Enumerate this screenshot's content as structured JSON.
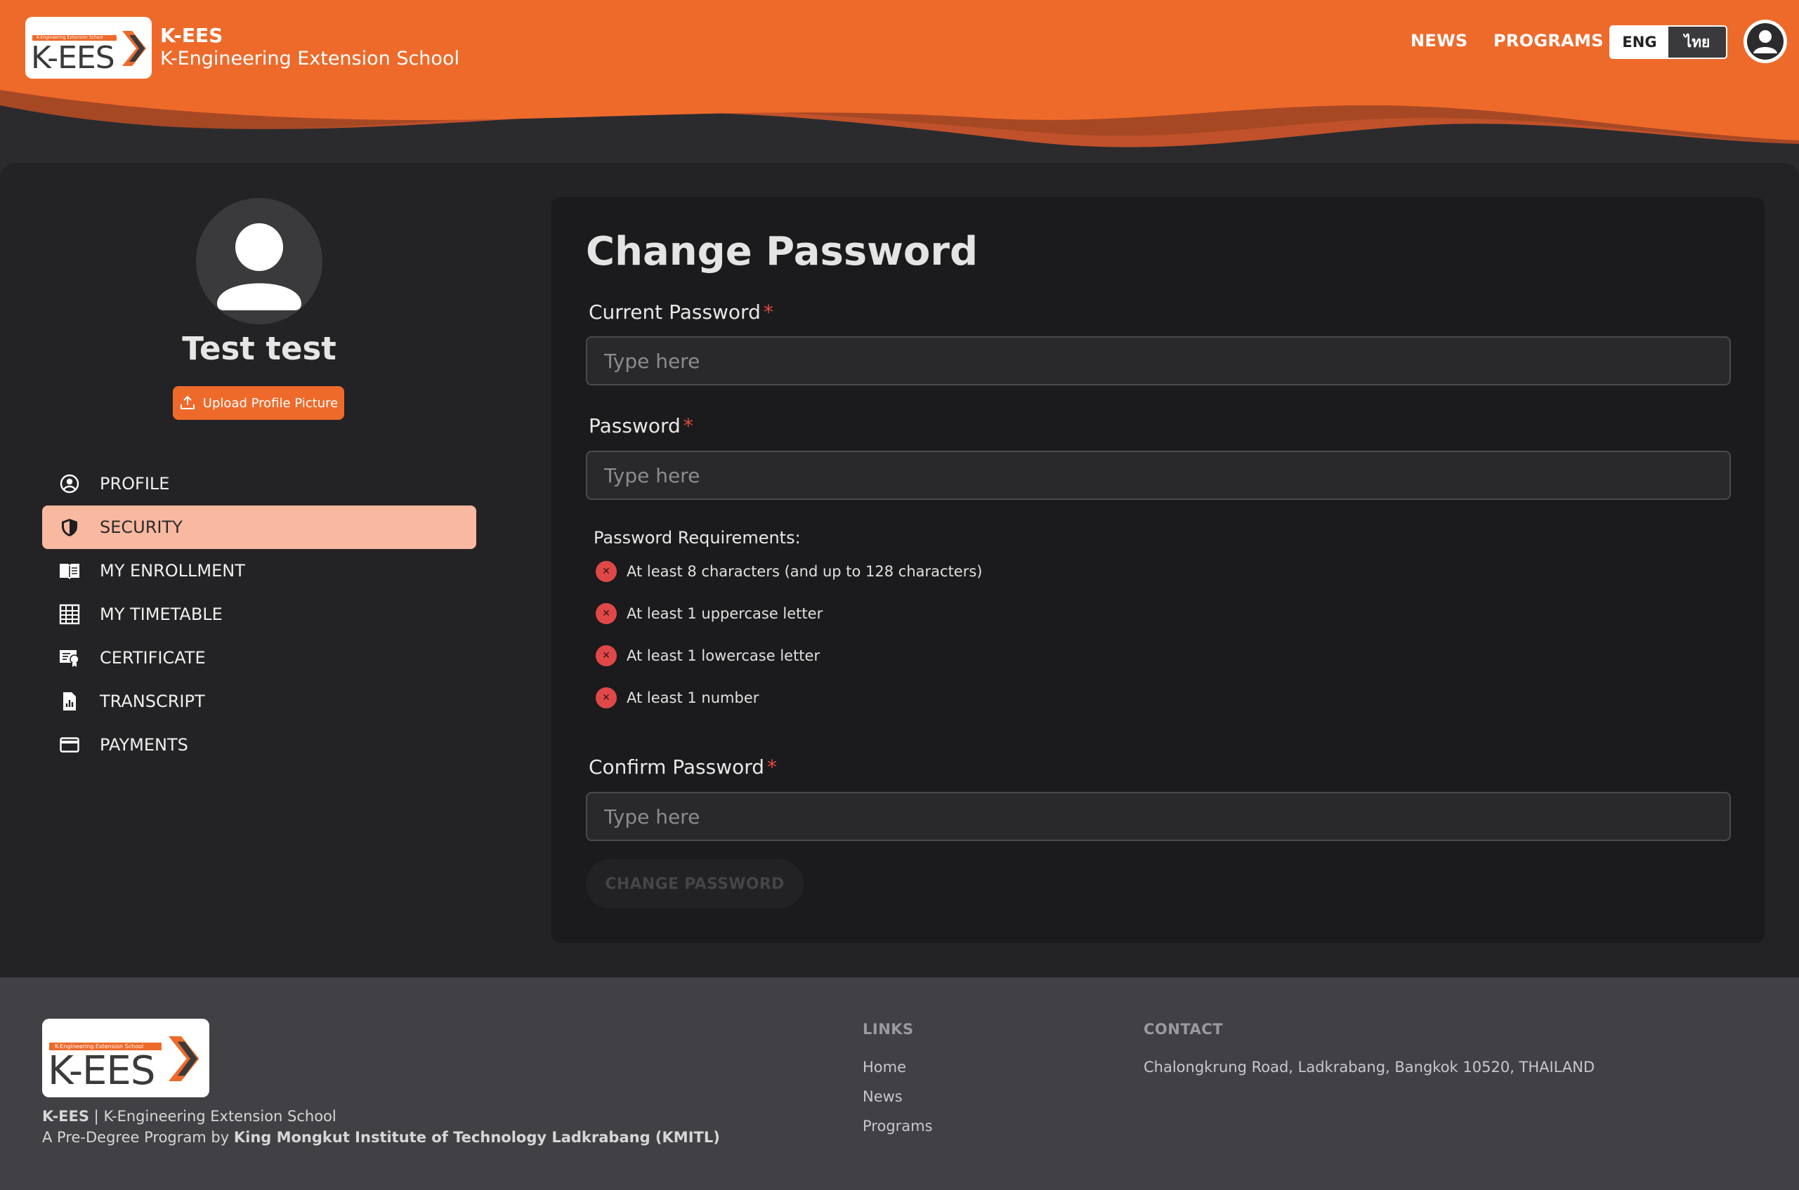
{
  "header": {
    "logo_strip": "K-Engineering Extension School",
    "logo_text": "K-EES",
    "brand_title": "K-EES",
    "brand_subtitle": "K-Engineering Extension School",
    "nav": {
      "news": "NEWS",
      "programs": "PROGRAMS"
    },
    "lang": {
      "eng": "ENG",
      "thai": "ไทย",
      "selected": "ENG"
    },
    "accent_color": "#ee6a2b"
  },
  "profile": {
    "name": "Test test",
    "upload_label": "Upload Profile Picture"
  },
  "sidebar": {
    "items": [
      {
        "label": "PROFILE",
        "icon": "account-circle-icon",
        "active": false
      },
      {
        "label": "SECURITY",
        "icon": "shield-icon",
        "active": true
      },
      {
        "label": "MY ENROLLMENT",
        "icon": "book-open-icon",
        "active": false
      },
      {
        "label": "MY TIMETABLE",
        "icon": "grid-table-icon",
        "active": false
      },
      {
        "label": "CERTIFICATE",
        "icon": "certificate-icon",
        "active": false
      },
      {
        "label": "TRANSCRIPT",
        "icon": "document-chart-icon",
        "active": false
      },
      {
        "label": "PAYMENTS",
        "icon": "credit-card-icon",
        "active": false
      }
    ]
  },
  "form": {
    "title": "Change Password",
    "current_password": {
      "label": "Current Password",
      "required": "*",
      "placeholder": "Type here",
      "value": ""
    },
    "password": {
      "label": "Password",
      "required": "*",
      "placeholder": "Type here",
      "value": ""
    },
    "requirements_title": "Password Requirements:",
    "requirements": [
      {
        "text": "At least 8 characters (and up to 128 characters)",
        "met": false
      },
      {
        "text": "At least 1 uppercase letter",
        "met": false
      },
      {
        "text": "At least 1 lowercase letter",
        "met": false
      },
      {
        "text": "At least 1 number",
        "met": false
      }
    ],
    "confirm_password": {
      "label": "Confirm Password",
      "required": "*",
      "placeholder": "Type here",
      "value": ""
    },
    "submit_label": "CHANGE PASSWORD",
    "submit_enabled": false
  },
  "footer": {
    "brand": "K-EES",
    "brand_full": "K-Engineering Extension School",
    "separator": "|",
    "tagline_prefix": "A Pre-Degree Program by",
    "institution": "King Mongkut Institute of Technology Ladkrabang (KMITL)",
    "links_heading": "LINKS",
    "links": [
      "Home",
      "News",
      "Programs"
    ],
    "contact_heading": "CONTACT",
    "contact_address": "Chalongkrung Road, Ladkrabang, Bangkok 10520, THAILAND"
  }
}
